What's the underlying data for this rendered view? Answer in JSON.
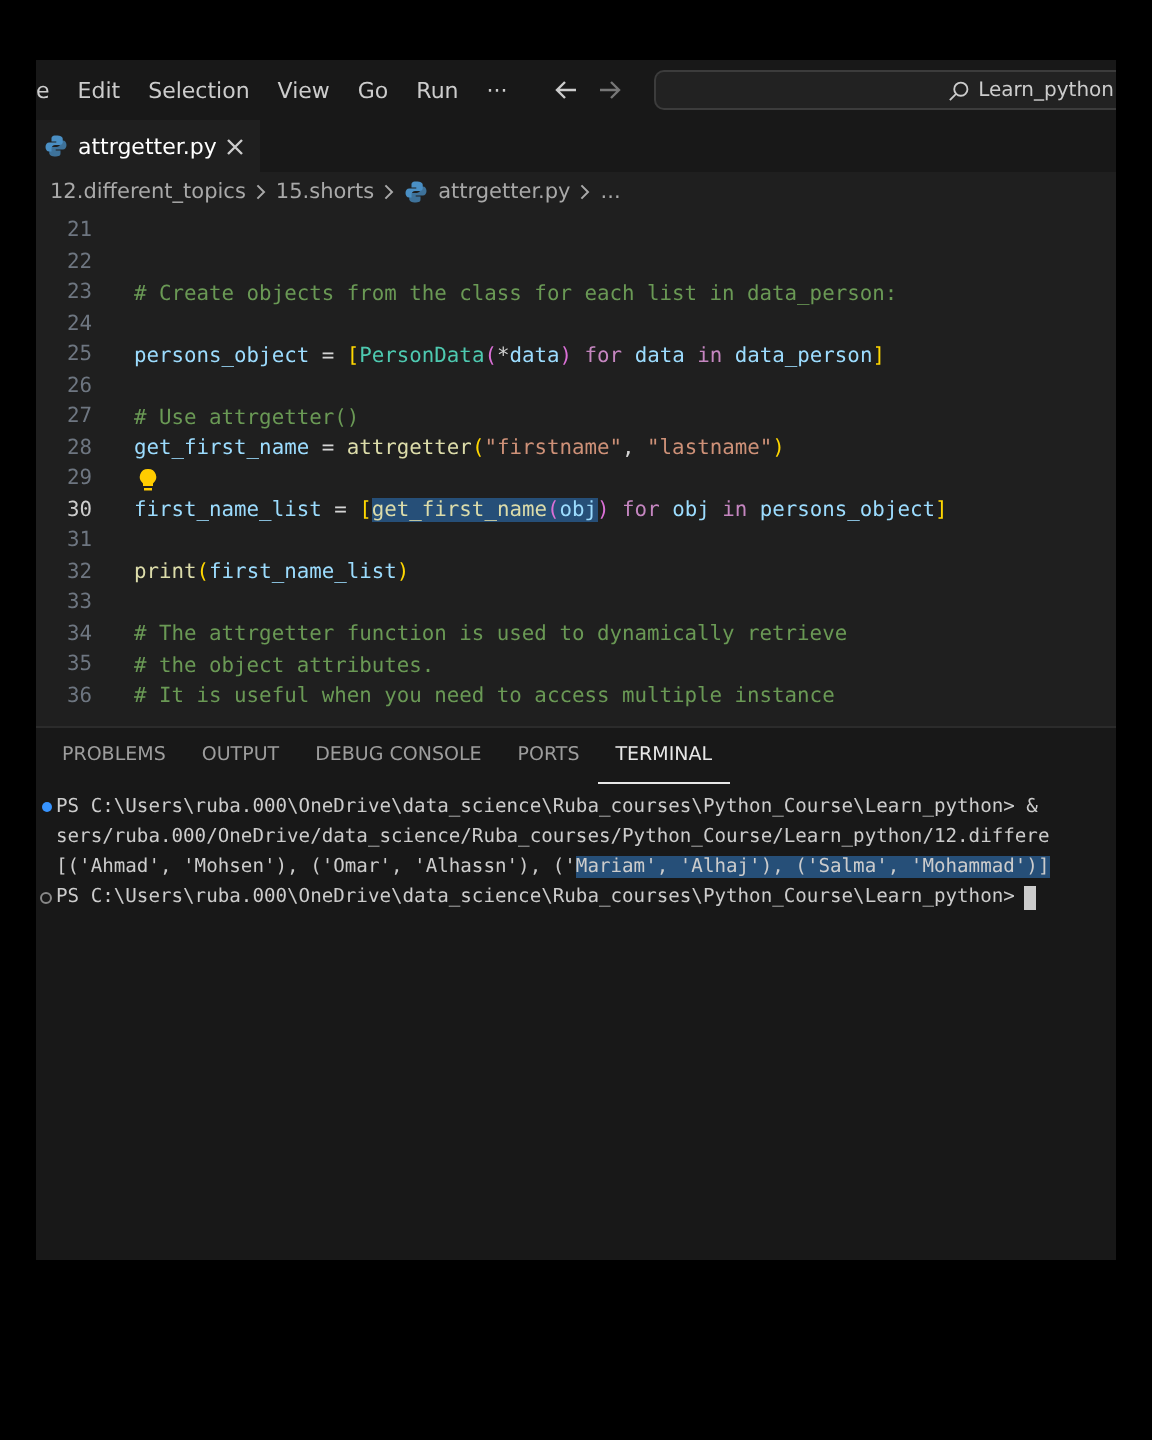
{
  "menu_bar": {
    "items": [
      "e",
      "Edit",
      "Selection",
      "View",
      "Go",
      "Run",
      "···"
    ],
    "search": {
      "value": "Learn_python"
    }
  },
  "tabs": [
    {
      "label": "attrgetter.py",
      "selected": true
    }
  ],
  "breadcrumb": [
    "12.different_topics",
    "15.shorts",
    "attrgetter.py",
    "..."
  ],
  "editor": {
    "lines": [
      {
        "number": "21",
        "current": false
      },
      {
        "number": "22",
        "current": false
      },
      {
        "number": "23",
        "current": false,
        "spans": [
          {
            "selected": false,
            "tokens": [
              {
                "kind": "comment",
                "text": "# Create objects from the class for each list in data_person:"
              }
            ]
          }
        ]
      },
      {
        "number": "24",
        "current": false
      },
      {
        "number": "25",
        "current": false,
        "spans": [
          {
            "selected": false,
            "tokens": [
              {
                "kind": "variable",
                "text": "persons_object"
              },
              {
                "kind": "plain",
                "text": " = "
              },
              {
                "kind": "bracket",
                "text": "["
              },
              {
                "kind": "class",
                "text": "PersonData"
              },
              {
                "kind": "paren",
                "text": "("
              },
              {
                "kind": "plain",
                "text": "*"
              },
              {
                "kind": "variable",
                "text": "data"
              },
              {
                "kind": "paren",
                "text": ")"
              },
              {
                "kind": "keyword",
                "text": " for"
              },
              {
                "kind": "variable",
                "text": " data "
              },
              {
                "kind": "keyword",
                "text": "in"
              },
              {
                "kind": "variable",
                "text": " data_person"
              },
              {
                "kind": "bracket",
                "text": "]"
              }
            ]
          }
        ]
      },
      {
        "number": "26",
        "current": false
      },
      {
        "number": "27",
        "current": false,
        "spans": [
          {
            "selected": false,
            "tokens": [
              {
                "kind": "comment",
                "text": "# Use attrgetter()"
              }
            ]
          }
        ]
      },
      {
        "number": "28",
        "current": false,
        "spans": [
          {
            "selected": false,
            "tokens": [
              {
                "kind": "variable",
                "text": "get_first_name"
              },
              {
                "kind": "plain",
                "text": " = "
              },
              {
                "kind": "function",
                "text": "attrgetter"
              },
              {
                "kind": "bracket",
                "text": "("
              },
              {
                "kind": "string",
                "text": "\"firstname\""
              },
              {
                "kind": "plain",
                "text": ", "
              },
              {
                "kind": "string",
                "text": "\"lastname\""
              },
              {
                "kind": "bracket",
                "text": ")"
              }
            ]
          }
        ]
      },
      {
        "number": "29",
        "current": false,
        "spans": [
          {
            "selected": false,
            "tokens": [
              {
                "kind": "lightbulb"
              }
            ]
          }
        ]
      },
      {
        "number": "30",
        "current": true,
        "spans": [
          {
            "selected": false,
            "tokens": [
              {
                "kind": "variable",
                "text": "first_name_list"
              },
              {
                "kind": "plain",
                "text": " = "
              },
              {
                "kind": "bracket",
                "text": "["
              }
            ]
          },
          {
            "selected": true,
            "tokens": [
              {
                "kind": "function",
                "text": "get_first_name"
              },
              {
                "kind": "paren",
                "text": "("
              },
              {
                "kind": "variable",
                "text": "obj"
              }
            ]
          },
          {
            "selected": false,
            "tokens": [
              {
                "kind": "paren",
                "text": ")"
              },
              {
                "kind": "keyword",
                "text": " for"
              },
              {
                "kind": "variable",
                "text": " obj "
              },
              {
                "kind": "keyword",
                "text": "in"
              },
              {
                "kind": "variable",
                "text": " persons_object"
              },
              {
                "kind": "bracket",
                "text": "]"
              }
            ]
          }
        ]
      },
      {
        "number": "31",
        "current": false
      },
      {
        "number": "32",
        "current": false,
        "spans": [
          {
            "selected": false,
            "tokens": [
              {
                "kind": "function",
                "text": "print"
              },
              {
                "kind": "bracket",
                "text": "("
              },
              {
                "kind": "variable",
                "text": "first_name_list"
              },
              {
                "kind": "bracket",
                "text": ")"
              }
            ]
          }
        ]
      },
      {
        "number": "33",
        "current": false
      },
      {
        "number": "34",
        "current": false,
        "spans": [
          {
            "selected": false,
            "tokens": [
              {
                "kind": "comment",
                "text": "# The attrgetter function is used to dynamically retrieve"
              }
            ]
          }
        ]
      },
      {
        "number": "35",
        "current": false,
        "spans": [
          {
            "selected": false,
            "tokens": [
              {
                "kind": "comment",
                "text": "# the object attributes."
              }
            ]
          }
        ]
      },
      {
        "number": "36",
        "current": false,
        "spans": [
          {
            "selected": false,
            "tokens": [
              {
                "kind": "comment",
                "text": "# It is useful when you need to access multiple instance"
              }
            ]
          }
        ]
      }
    ]
  },
  "panel": {
    "tabs": [
      {
        "label": "PROBLEMS",
        "selected": false
      },
      {
        "label": "OUTPUT",
        "selected": false
      },
      {
        "label": "DEBUG CONSOLE",
        "selected": false
      },
      {
        "label": "PORTS",
        "selected": false
      },
      {
        "label": "TERMINAL",
        "selected": true
      }
    ],
    "terminal": [
      {
        "kind": "command",
        "cursor": false,
        "segments": [
          {
            "text": "PS C:\\Users\\ruba.000\\OneDrive\\data_science\\Ruba_courses\\Python_Course\\Learn_python> &",
            "selected": false
          }
        ]
      },
      {
        "kind": "output",
        "cursor": false,
        "segments": [
          {
            "text": "sers/ruba.000/OneDrive/data_science/Ruba_courses/Python_Course/Learn_python/12.differe",
            "selected": false
          }
        ]
      },
      {
        "kind": "output",
        "cursor": false,
        "segments": [
          {
            "text": "[('Ahmad', 'Mohsen'), ('Omar', 'Alhassn'), ('",
            "selected": false
          },
          {
            "text": "Mariam', 'Alhaj'), ('Salma', 'Mohammad')]",
            "selected": true
          }
        ]
      },
      {
        "kind": "prompt",
        "cursor": true,
        "segments": [
          {
            "text": "PS C:\\Users\\ruba.000\\OneDrive\\data_science\\Ruba_courses\\Python_Course\\Learn_python>",
            "selected": false
          }
        ]
      }
    ]
  }
}
